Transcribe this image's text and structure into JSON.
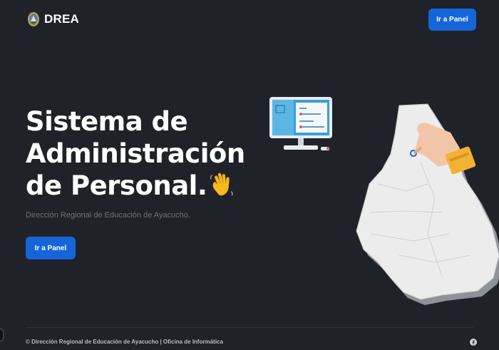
{
  "header": {
    "brand": "DREA",
    "cta_label": "Ir a Panel"
  },
  "hero": {
    "title_line1": "Sistema de",
    "title_line2": "Administración",
    "title_line3": "de Personal.",
    "subtitle": "Dirección Regional de Educación de Ayacucho.",
    "cta_label": "Ir a Panel"
  },
  "footer": {
    "copyright": "© Dirección Regional de Educación de Ayacucho | Oficina de Informática",
    "social_icon": "facebook-icon"
  },
  "colors": {
    "background": "#1f2228",
    "accent": "#1565d8",
    "muted_text": "#6c7280"
  }
}
